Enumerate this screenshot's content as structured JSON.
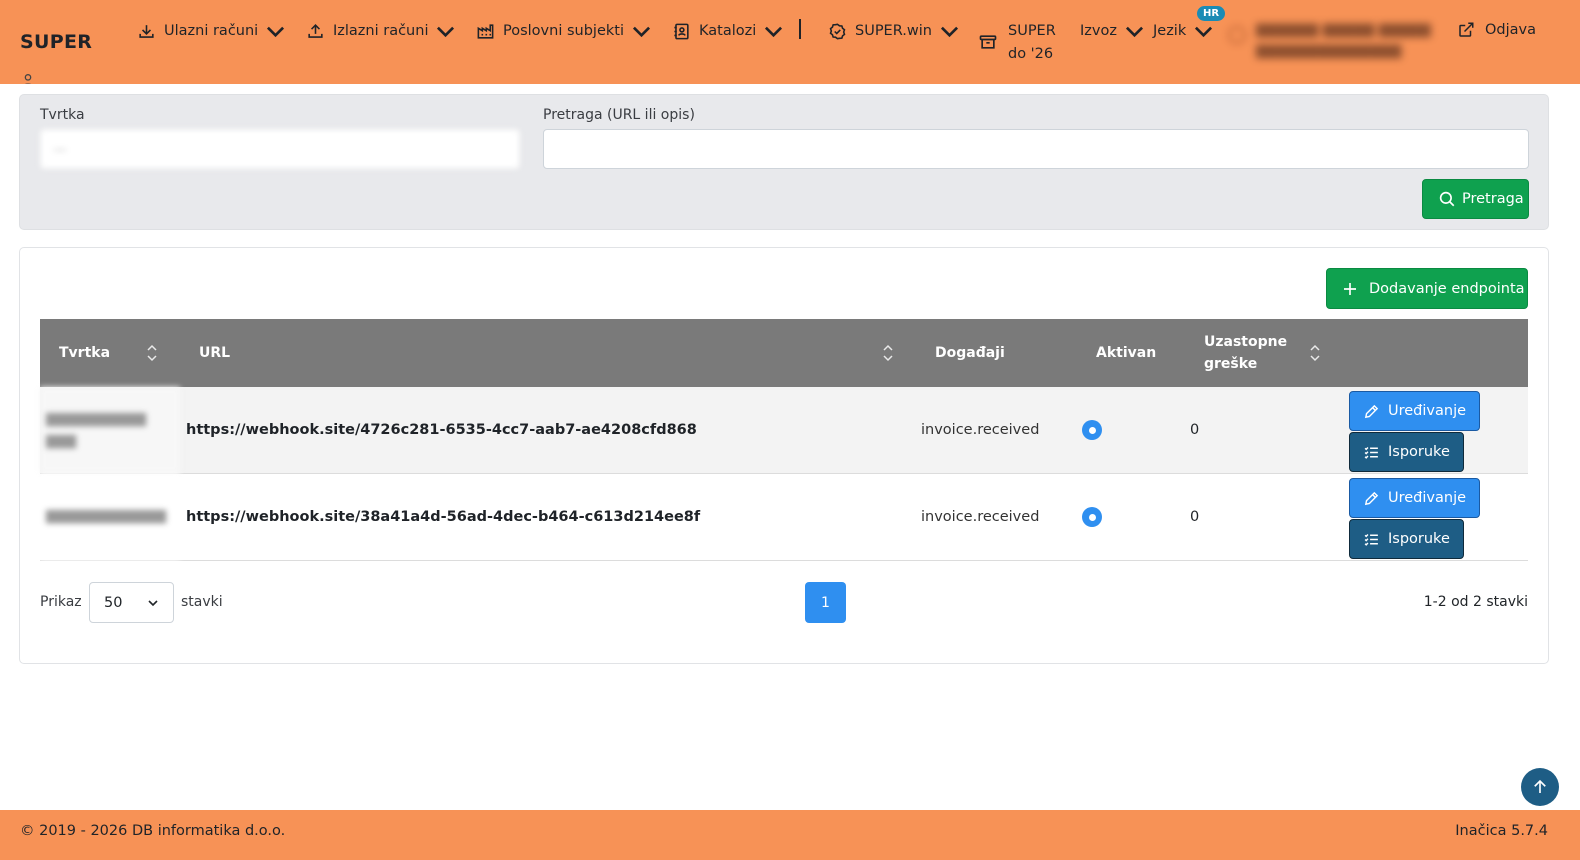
{
  "brand": "SUPER",
  "nav": {
    "incoming": "Ulazni računi",
    "outgoing": "Izlazni računi",
    "partners": "Poslovni subjekti",
    "catalogs": "Katalozi",
    "superwin": "SUPER.win",
    "super26_line1": "SUPER",
    "super26_line2": "do '26",
    "export": "Izvoz",
    "language": "Jezik",
    "language_badge": "HR",
    "logout": "Odjava"
  },
  "filter": {
    "company_label": "Tvrtka",
    "company_value": "—",
    "search_label": "Pretraga (URL ili opis)",
    "search_value": "",
    "search_button": "Pretraga"
  },
  "add_button": "Dodavanje endpointa",
  "table": {
    "headers": {
      "company": "Tvrtka",
      "url": "URL",
      "events": "Događaji",
      "active": "Aktivan",
      "errors_line1": "Uzastopne",
      "errors_line2": "greške"
    },
    "rows": [
      {
        "url": "https://webhook.site/4726c281-6535-4cc7-aab7-ae4208cfd868",
        "events": "invoice.received",
        "active": true,
        "errors": "0",
        "edit": "Uređivanje",
        "deliveries": "Isporuke"
      },
      {
        "url": "https://webhook.site/38a41a4d-56ad-4dec-b464-c613d214ee8f",
        "events": "invoice.received",
        "active": true,
        "errors": "0",
        "edit": "Uređivanje",
        "deliveries": "Isporuke"
      }
    ]
  },
  "pagination": {
    "show_label": "Prikaz",
    "page_size": "50",
    "items_label": "stavki",
    "current_page": "1",
    "summary": "1-2 od 2 stavki"
  },
  "footer": {
    "copyright": "© 2019 - 2026 DB informatika d.o.o.",
    "version": "Inačica 5.7.4"
  },
  "colors": {
    "brand_orange": "#f79256",
    "primary_blue": "#2f8ff0",
    "dark_blue": "#1e5d85",
    "success_green": "#0fa14f",
    "table_header": "#7a7a7a"
  }
}
